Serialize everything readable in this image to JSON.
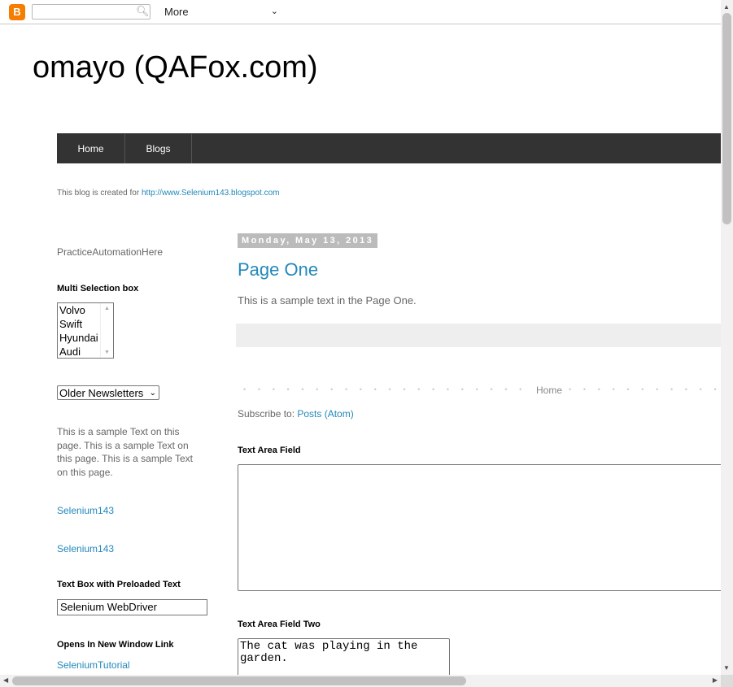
{
  "topbar": {
    "logo_letter": "B",
    "search_placeholder": "",
    "more_label": "More"
  },
  "blog": {
    "title": "omayo (QAFox.com)",
    "description_prefix": "This blog is created for ",
    "description_link": "http://www.Selenium143.blogspot.com"
  },
  "nav": {
    "tabs": [
      {
        "label": "Home"
      },
      {
        "label": "Blogs"
      }
    ]
  },
  "sidebar": {
    "practice_text": "PracticeAutomationHere",
    "multi_select_heading": "Multi Selection box",
    "multi_select_options": [
      "Volvo",
      "Swift",
      "Hyundai",
      "Audi"
    ],
    "dropdown_value": "Older Newsletters",
    "sample_text": "This is a sample Text on this page. This is a sample Text on this page. This is a sample Text on this page.",
    "link_one": "Selenium143",
    "link_two": "Selenium143",
    "preloaded_heading": "Text Box with Preloaded Text",
    "preloaded_value": "Selenium WebDriver",
    "new_window_heading": "Opens In New Window Link",
    "new_window_link": "SeleniumTutorial"
  },
  "main": {
    "date_header": "Monday, May 13, 2013",
    "post_title": "Page One",
    "post_body": "This is a sample text in the Page One.",
    "home_link": "Home",
    "subscribe_prefix": "Subscribe to: ",
    "subscribe_link": "Posts (Atom)",
    "textarea_heading": "Text Area Field",
    "textarea_value": "",
    "textarea_two_heading": "Text Area Field Two",
    "textarea_two_value": "The cat was playing in the garden."
  }
}
